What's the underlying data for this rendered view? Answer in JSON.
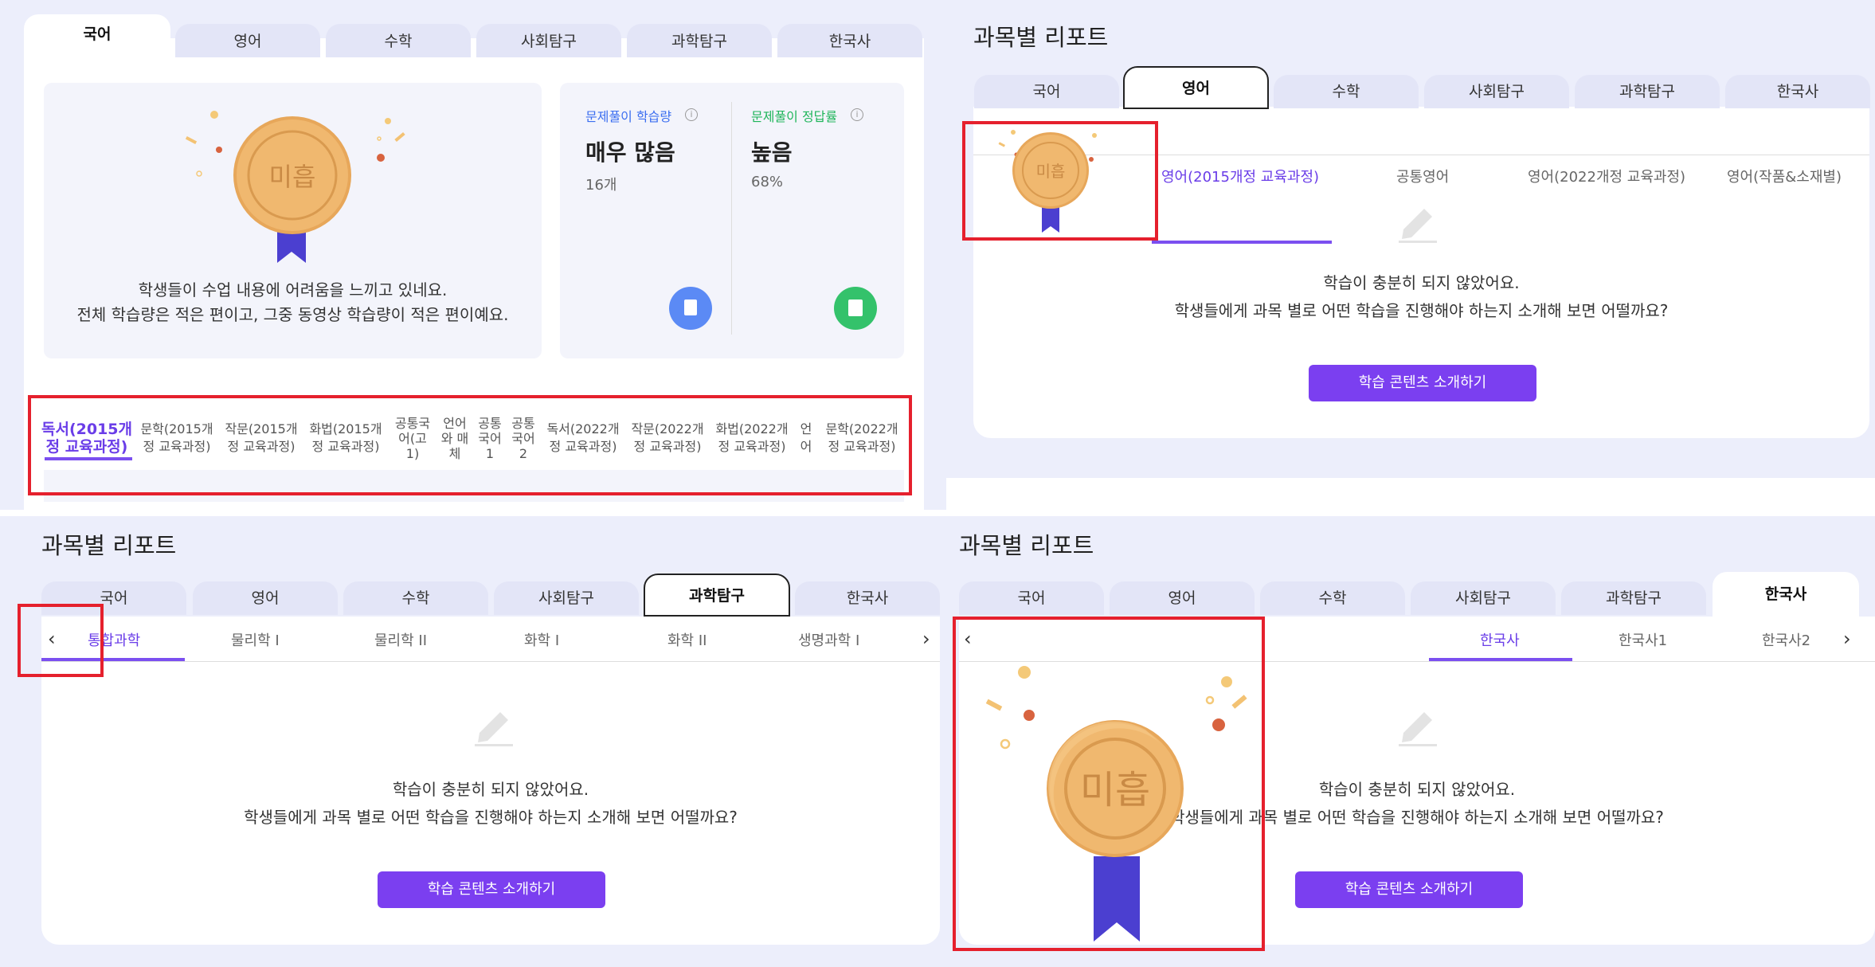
{
  "subjects": [
    "국어",
    "영어",
    "수학",
    "사회탐구",
    "과학탐구",
    "한국사"
  ],
  "report_title": "과목별 리포트",
  "medal_label": "미흡",
  "p1": {
    "desc_line1": "학생들이 수업 내용에 어려움을 느끼고 있네요.",
    "desc_line2": "전체 학습량은 적은 편이고, 그중 동영상 학습량이 적은 편이예요.",
    "stat1": {
      "label": "문제풀이 학습량",
      "value": "매우 많음",
      "sub": "16개"
    },
    "stat2": {
      "label": "문제풀이 정답률",
      "value": "높음",
      "sub": "68%"
    },
    "subtabs": [
      {
        "l1": "독서(2015개",
        "l2": "정 교육과정)"
      },
      {
        "l1": "문학(2015개",
        "l2": "정 교육과정)"
      },
      {
        "l1": "작문(2015개",
        "l2": "정 교육과정)"
      },
      {
        "l1": "화법(2015개",
        "l2": "정 교육과정)"
      },
      {
        "l1": "공통국",
        "l2": "어(고",
        "l3": "1)"
      },
      {
        "l1": "언어",
        "l2": "와 매",
        "l3": "체"
      },
      {
        "l1": "공통",
        "l2": "국어",
        "l3": "1"
      },
      {
        "l1": "공통",
        "l2": "국어",
        "l3": "2"
      },
      {
        "l1": "독서(2022개",
        "l2": "정 교육과정)"
      },
      {
        "l1": "작문(2022개",
        "l2": "정 교육과정)"
      },
      {
        "l1": "화법(2022개",
        "l2": "정 교육과정)"
      },
      {
        "l1": "언",
        "l2": "어"
      },
      {
        "l1": "문학(2022개",
        "l2": "정 교육과정)"
      }
    ]
  },
  "p2": {
    "subtabs": [
      "영어(2015개정 교육과정)",
      "공통영어",
      "영어(2022개정 교육과정)",
      "영어(작품&소재별)"
    ]
  },
  "p3": {
    "subtabs": [
      "통합과학",
      "물리학 I",
      "물리학 II",
      "화학 I",
      "화학 II",
      "생명과학 I"
    ]
  },
  "p4": {
    "subtabs": [
      "한국사",
      "한국사1",
      "한국사2"
    ]
  },
  "empty": {
    "line1": "학습이 충분히 되지 않았어요.",
    "line2": "학생들에게 과목 별로 어떤 학습을 진행해야 하는지 소개해 보면 어떨까요?",
    "button": "학습 콘텐츠 소개하기"
  },
  "colors": {
    "accent": "#7b3ff0",
    "red_box": "#e5202d",
    "tab_bg": "#e3e5f7",
    "panel_bg": "#eceefb",
    "stat1": "#3b6ef0",
    "stat2": "#1fb55a"
  }
}
